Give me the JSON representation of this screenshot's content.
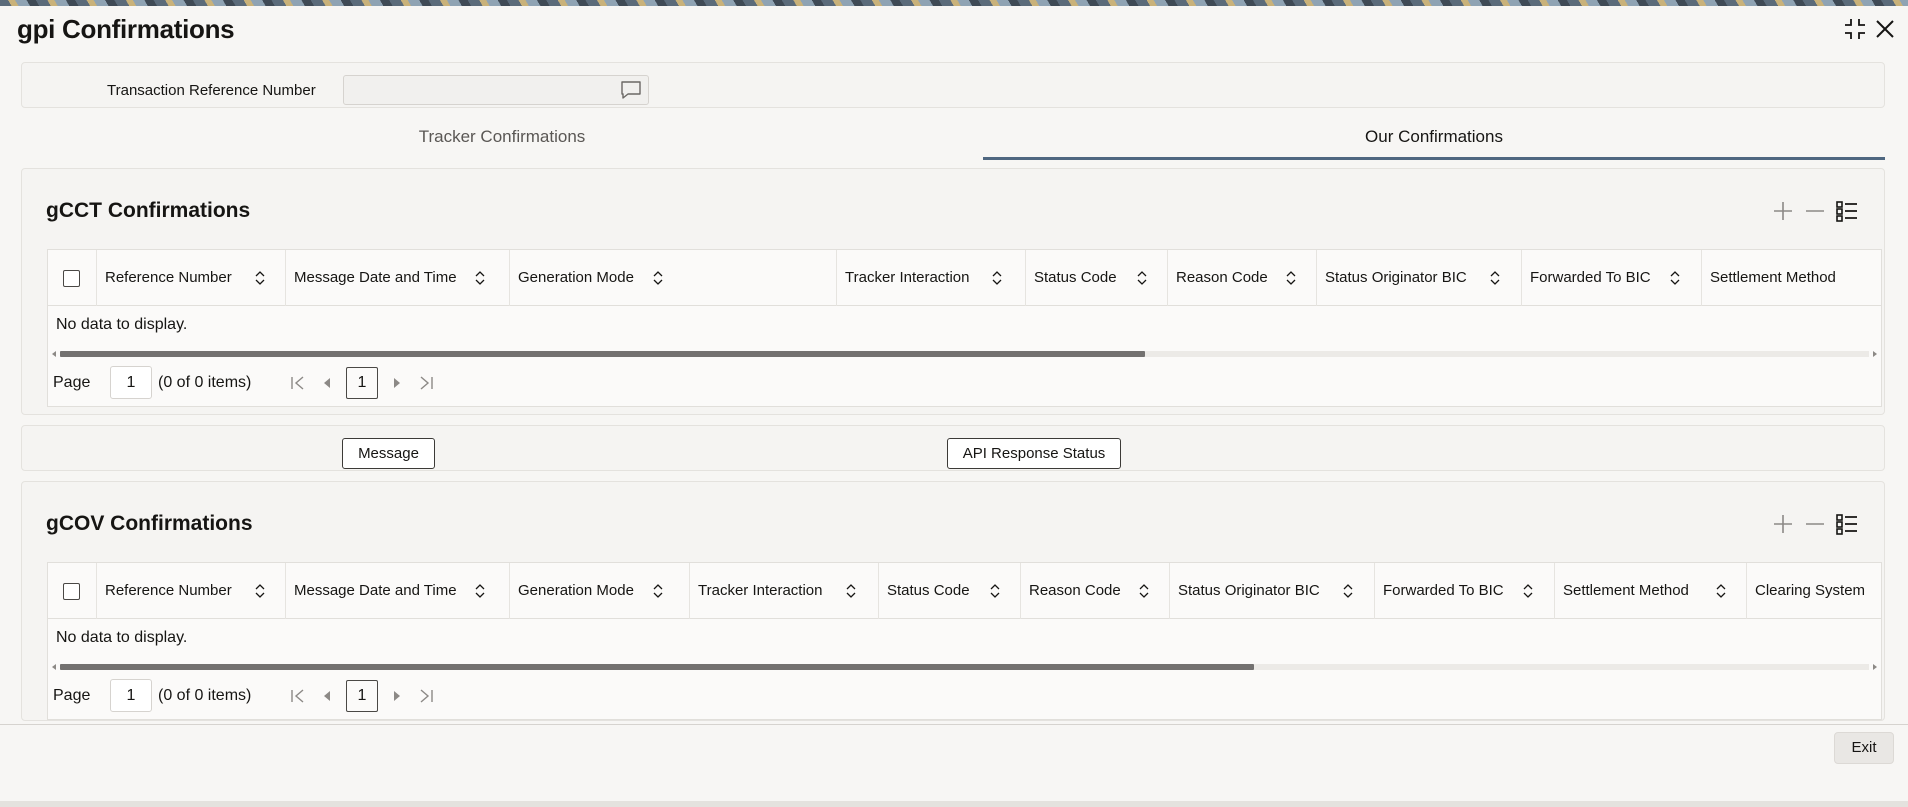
{
  "window": {
    "title": "gpi Confirmations",
    "minimize_icon": "collapse-icon",
    "close_icon": "close-icon"
  },
  "reference": {
    "label": "Transaction Reference Number",
    "value": "",
    "placeholder": ""
  },
  "tabs": [
    {
      "label": "Tracker Confirmations",
      "active": false
    },
    {
      "label": "Our Confirmations",
      "active": true
    }
  ],
  "gcct": {
    "title": "gCCT Confirmations",
    "columns": [
      "Reference Number",
      "Message Date and Time",
      "Generation Mode",
      "Tracker Interaction",
      "Status Code",
      "Reason Code",
      "Status Originator BIC",
      "Forwarded To BIC",
      "Settlement Method"
    ],
    "empty_text": "No data to display.",
    "scroll_fraction": 0.6,
    "pager": {
      "page_label": "Page",
      "page_value": "1",
      "items_text": "(0 of 0 items)",
      "current_page": "1"
    }
  },
  "buttons": {
    "message": "Message",
    "api_status": "API Response Status"
  },
  "gcov": {
    "title": "gCOV Confirmations",
    "columns": [
      "Reference Number",
      "Message Date and Time",
      "Generation Mode",
      "Tracker Interaction",
      "Status Code",
      "Reason Code",
      "Status Originator BIC",
      "Forwarded To BIC",
      "Settlement Method",
      "Clearing System"
    ],
    "empty_text": "No data to display.",
    "scroll_fraction": 0.66,
    "pager": {
      "page_label": "Page",
      "page_value": "1",
      "items_text": "(0 of 0 items)",
      "current_page": "1"
    }
  },
  "footer": {
    "exit": "Exit"
  },
  "colors": {
    "active_tab_underline": "#4f6780",
    "background": "#f7f6f4"
  }
}
